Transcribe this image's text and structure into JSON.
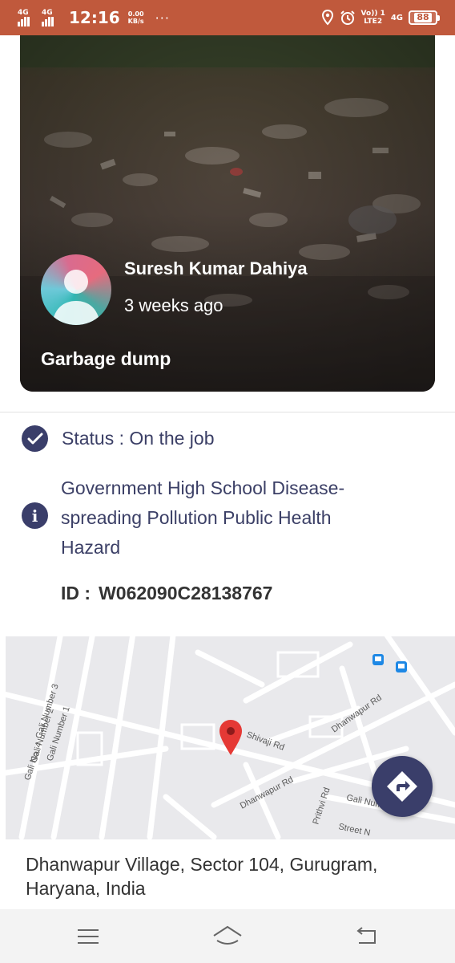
{
  "status_bar": {
    "sim1": "4G",
    "sim2": "4G",
    "time": "12:16",
    "speed_value": "0.00",
    "speed_unit": "KB/s",
    "more": "···",
    "volte": "Vo)) 1",
    "lte": "LTE2",
    "network": "4G",
    "battery": "88"
  },
  "report": {
    "reporter_name": "Suresh Kumar Dahiya",
    "time_ago": "3 weeks ago",
    "title": "Garbage dump",
    "status": "Status : On the job",
    "description": "Government High School Disease-\nspreading  Pollution  Public Health\nHazard",
    "id_label": "ID :",
    "id_value": "W062090C28138767"
  },
  "map": {
    "street_labels": [
      "Gali No. 4",
      "Gali Number 3",
      "Gali Number 2",
      "Gali Number 1",
      "Shivaji Rd",
      "Dhanwapur Rd",
      "Dhanwapur Rd",
      "Prithvi Rd",
      "Gali Number 19",
      "Street N"
    ]
  },
  "address": "Dhanwapur Village, Sector 104, Gurugram, Haryana, India",
  "icons": {
    "status": "check-circle-icon",
    "info": "info-icon",
    "navigate": "directions-icon",
    "menu": "menu-icon",
    "home": "home-icon",
    "back": "back-icon"
  },
  "colors": {
    "status_bar": "#c0593c",
    "accent": "#3a3e6a",
    "map_pin": "#e53935"
  }
}
